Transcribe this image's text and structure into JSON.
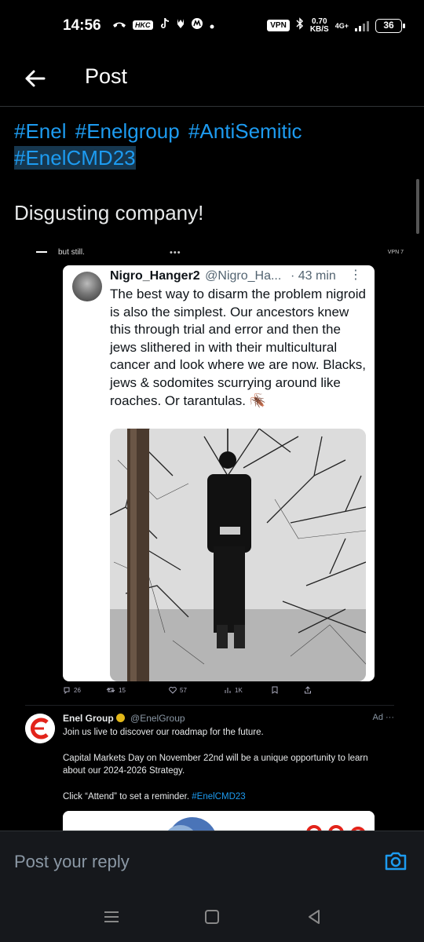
{
  "status_bar": {
    "time": "14:56",
    "hkc_label": "HKC",
    "vpn_label": "VPN",
    "speed_value": "0.70",
    "speed_unit": "KB/S",
    "network": "4G+",
    "battery": "36"
  },
  "header": {
    "title": "Post"
  },
  "post": {
    "hashtags": [
      "#Enel",
      "#Enelgroup",
      "#AntiSemitic",
      "#EnelCMD23"
    ],
    "text": "Disgusting company!"
  },
  "embedded_screenshot": {
    "top_text": "but still.",
    "dots": "•••",
    "status": "VPN 7",
    "tweet": {
      "name": "Nigro_Hanger2",
      "handle": "@Nigro_Ha...",
      "time": "· 43 min",
      "more": "⋮",
      "body": "The best way to disarm the problem nigroid is also the simplest. Our ancestors knew this through trial and error and then the jews slithered in with their multicultural cancer and look where we are now. Blacks, jews & sodomites scurrying around like roaches. Or tarantulas. 🪳",
      "actions": {
        "replies": "26",
        "reposts": "15",
        "likes": "57",
        "views": "1K"
      }
    },
    "ad": {
      "name": "Enel Group",
      "handle": "@EnelGroup",
      "tag": "Ad ···",
      "line1": "Join us live to discover our roadmap for the future.",
      "line2": "Capital Markets Day on November 22nd will be a unique opportunity to learn about our 2024-2026 Strategy.",
      "line3_prefix": "Click “Attend” to set a reminder.",
      "line3_link": "#EnelCMD23"
    }
  },
  "reply": {
    "placeholder": "Post your reply"
  },
  "colors": {
    "accent": "#1d9bf0",
    "background": "#000000",
    "enel_red": "#e2231a"
  }
}
